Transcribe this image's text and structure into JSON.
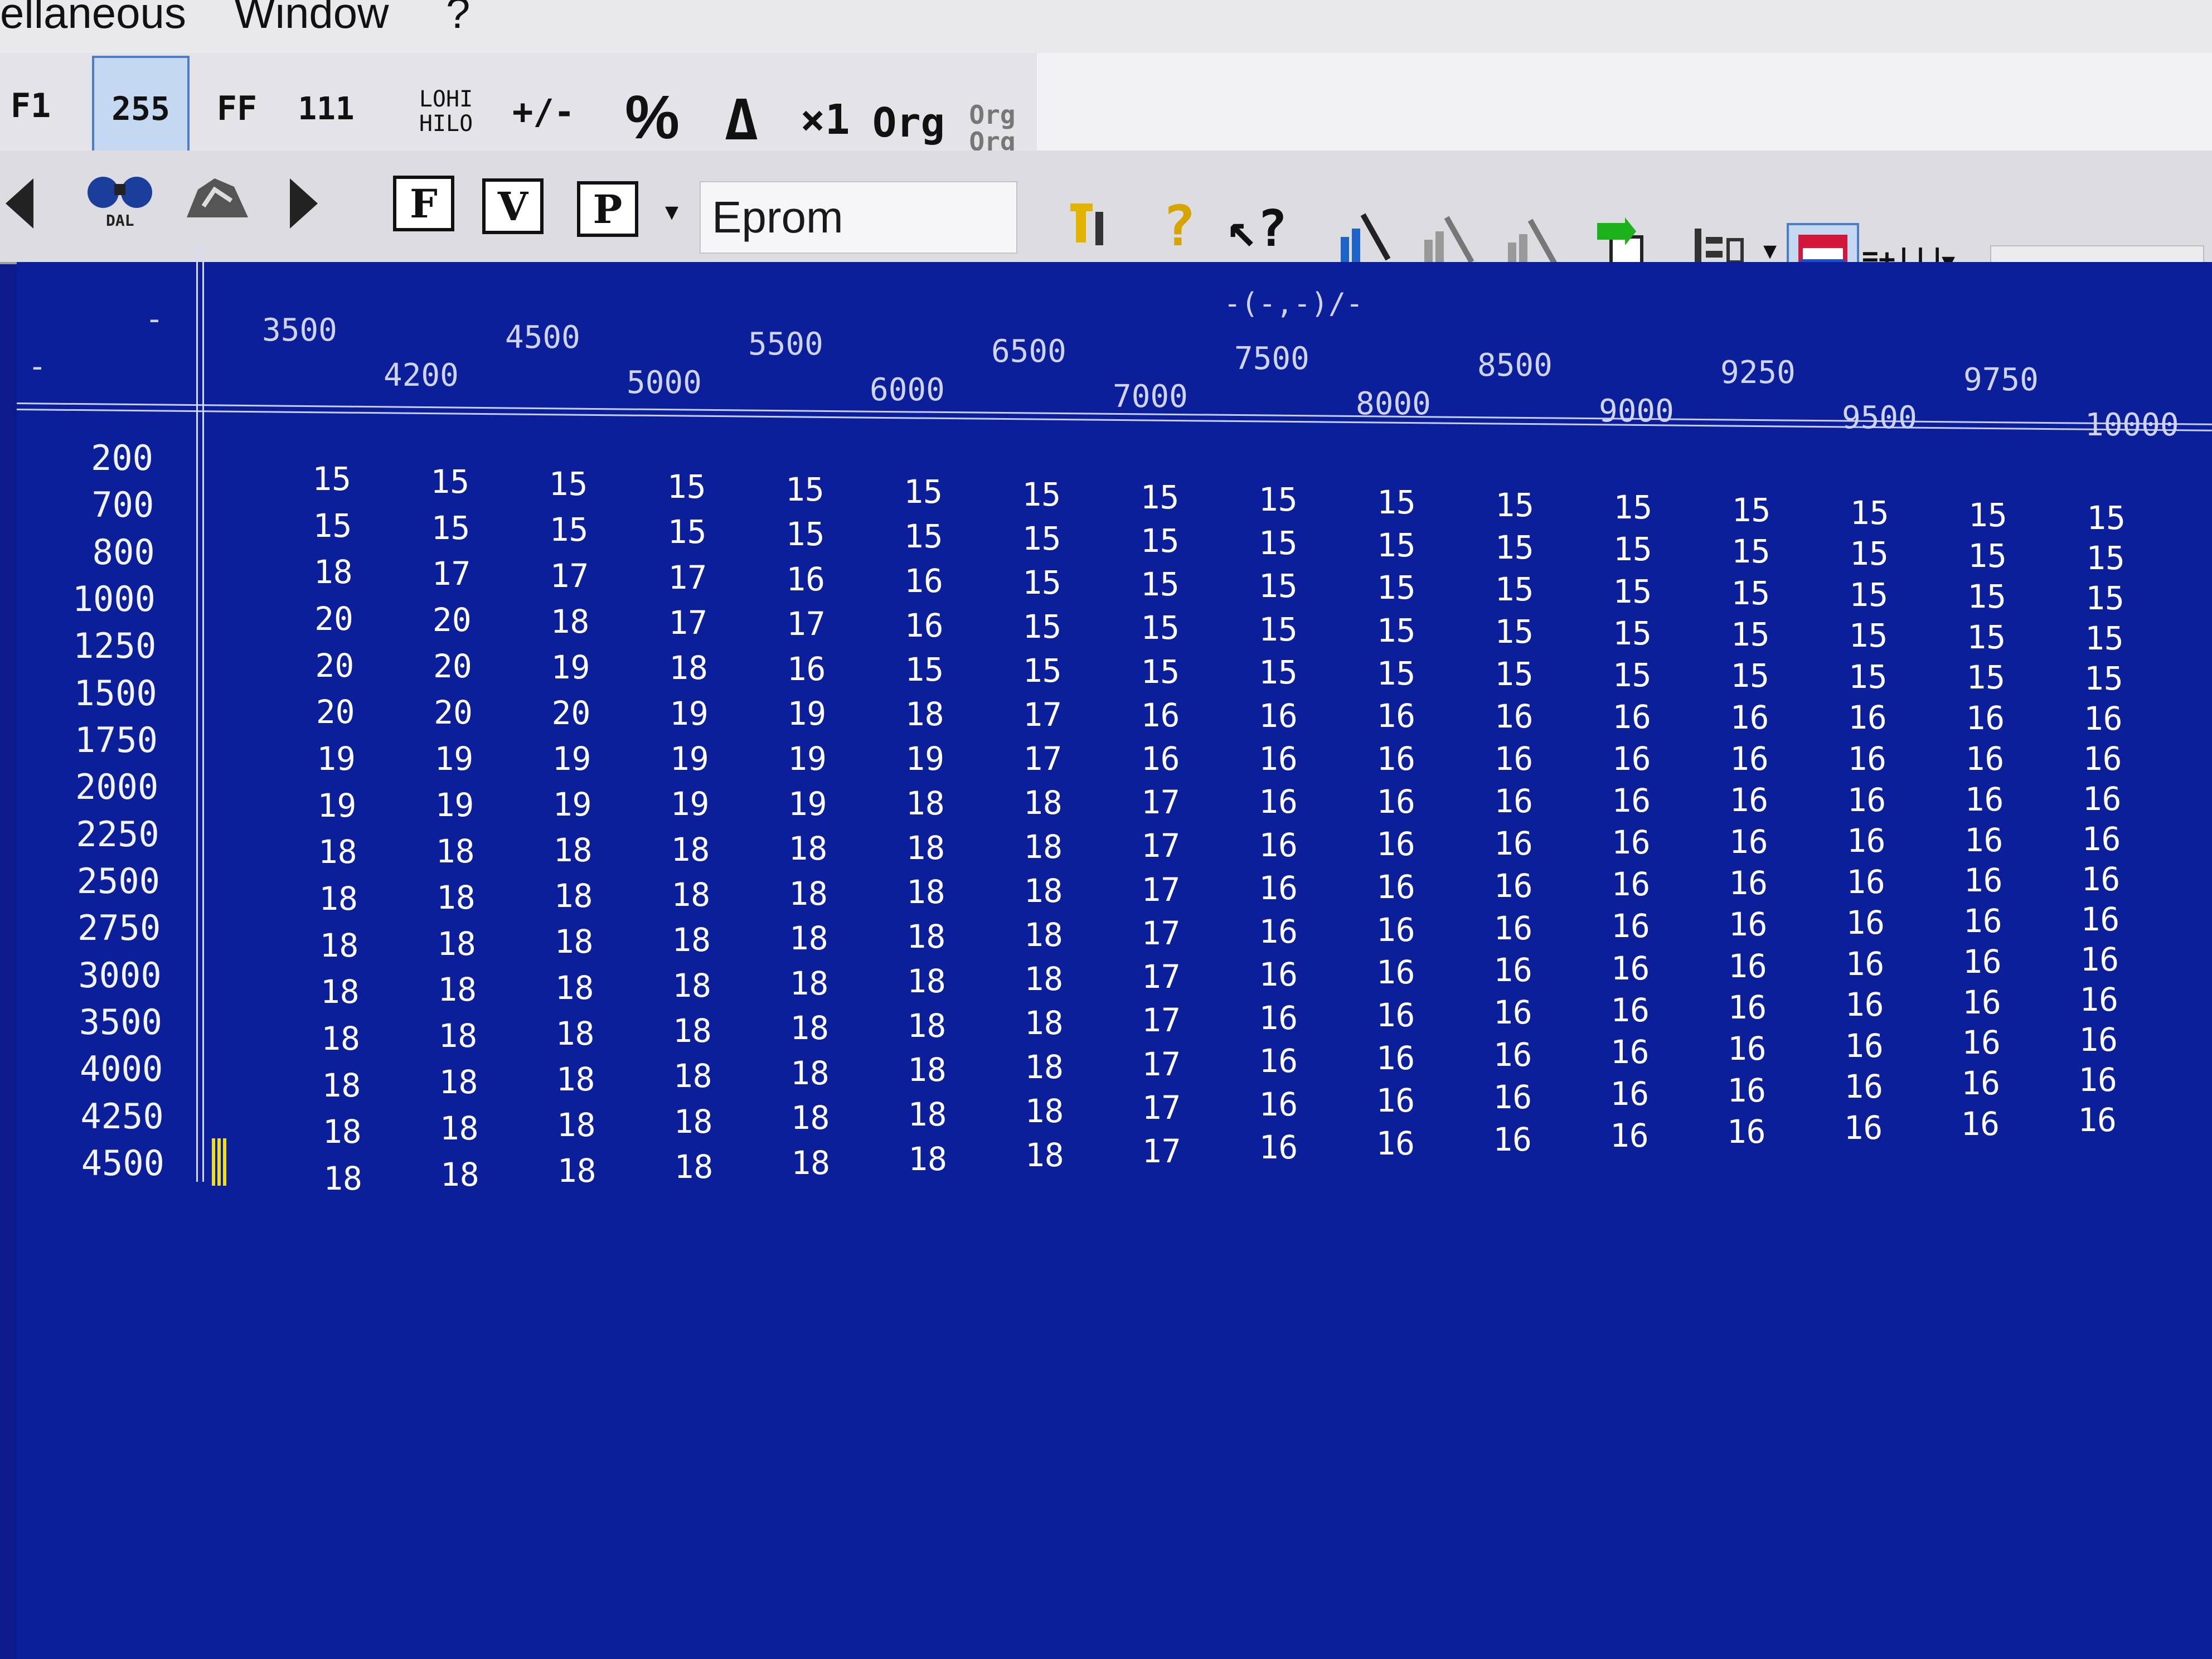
{
  "menu": {
    "miscellaneous": "ellaneous",
    "window": "Window",
    "help": "?"
  },
  "toolbar": {
    "buttons_row1": [
      {
        "icon": "decimal-view-icon",
        "label": "255"
      },
      {
        "icon": "hex-view-icon",
        "label": "FF"
      },
      {
        "icon": "binary-view-icon",
        "label": "111"
      },
      {
        "icon": "lohi-swap-icon",
        "label": "LOHI HILO"
      },
      {
        "icon": "sign-toggle-icon",
        "label": "+/-"
      },
      {
        "icon": "percent-icon",
        "label": "%"
      },
      {
        "icon": "delta-icon",
        "label": "Δ"
      },
      {
        "icon": "factor-icon",
        "label": "×1"
      },
      {
        "icon": "original-icon",
        "label": "Org"
      },
      {
        "icon": "original-compare-icon",
        "label": "Org Org"
      }
    ],
    "buttons_row2": [
      {
        "icon": "arrow-left-icon"
      },
      {
        "icon": "find-icon",
        "label": "DAL"
      },
      {
        "icon": "map-icon"
      },
      {
        "icon": "arrow-right-icon"
      },
      {
        "icon": "f-button-icon",
        "label": "F"
      },
      {
        "icon": "v-button-icon",
        "label": "V"
      },
      {
        "icon": "p-button-icon",
        "label": "P"
      }
    ],
    "mode_select": "Eprom",
    "right_icons": [
      "tools-icon",
      "help-icon",
      "context-help-icon",
      "chart-wand-icon",
      "chart-wand-2-icon",
      "chart-wand-3-icon",
      "import-icon",
      "layout-icon",
      "window-icon",
      "columns-icon"
    ]
  },
  "grid": {
    "axis_units": "-(-,-)/-",
    "row_axis_label": "-",
    "col_axis_label": "-",
    "columns": [
      "3500",
      "4200",
      "4500",
      "5000",
      "5500",
      "6000",
      "6500",
      "7000",
      "7500",
      "8000",
      "8500",
      "9000",
      "9250",
      "9500",
      "9750",
      "10000"
    ],
    "rows": [
      "200",
      "700",
      "800",
      "1000",
      "1250",
      "1500",
      "1750",
      "2000",
      "2250",
      "2500",
      "2750",
      "3000",
      "3500",
      "4000",
      "4250",
      "4500"
    ],
    "values": [
      [
        "15",
        "15",
        "15",
        "15",
        "15",
        "15",
        "15",
        "15",
        "15",
        "15",
        "15",
        "15",
        "15",
        "15",
        "15",
        "15"
      ],
      [
        "15",
        "15",
        "15",
        "15",
        "15",
        "15",
        "15",
        "15",
        "15",
        "15",
        "15",
        "15",
        "15",
        "15",
        "15",
        "15"
      ],
      [
        "18",
        "17",
        "17",
        "17",
        "16",
        "16",
        "15",
        "15",
        "15",
        "15",
        "15",
        "15",
        "15",
        "15",
        "15",
        "15"
      ],
      [
        "20",
        "20",
        "18",
        "17",
        "17",
        "16",
        "15",
        "15",
        "15",
        "15",
        "15",
        "15",
        "15",
        "15",
        "15",
        "15"
      ],
      [
        "20",
        "20",
        "19",
        "18",
        "16",
        "15",
        "15",
        "15",
        "15",
        "15",
        "15",
        "15",
        "15",
        "15",
        "15",
        "15"
      ],
      [
        "20",
        "20",
        "20",
        "19",
        "19",
        "18",
        "17",
        "16",
        "16",
        "16",
        "16",
        "16",
        "16",
        "16",
        "16",
        "16"
      ],
      [
        "19",
        "19",
        "19",
        "19",
        "19",
        "19",
        "17",
        "16",
        "16",
        "16",
        "16",
        "16",
        "16",
        "16",
        "16",
        "16"
      ],
      [
        "19",
        "19",
        "19",
        "19",
        "19",
        "18",
        "18",
        "17",
        "16",
        "16",
        "16",
        "16",
        "16",
        "16",
        "16",
        "16"
      ],
      [
        "18",
        "18",
        "18",
        "18",
        "18",
        "18",
        "18",
        "17",
        "16",
        "16",
        "16",
        "16",
        "16",
        "16",
        "16",
        "16"
      ],
      [
        "18",
        "18",
        "18",
        "18",
        "18",
        "18",
        "18",
        "17",
        "16",
        "16",
        "16",
        "16",
        "16",
        "16",
        "16",
        "16"
      ],
      [
        "18",
        "18",
        "18",
        "18",
        "18",
        "18",
        "18",
        "17",
        "16",
        "16",
        "16",
        "16",
        "16",
        "16",
        "16",
        "16"
      ],
      [
        "18",
        "18",
        "18",
        "18",
        "18",
        "18",
        "18",
        "17",
        "16",
        "16",
        "16",
        "16",
        "16",
        "16",
        "16",
        "16"
      ],
      [
        "18",
        "18",
        "18",
        "18",
        "18",
        "18",
        "18",
        "17",
        "16",
        "16",
        "16",
        "16",
        "16",
        "16",
        "16",
        "16"
      ],
      [
        "18",
        "18",
        "18",
        "18",
        "18",
        "18",
        "18",
        "17",
        "16",
        "16",
        "16",
        "16",
        "16",
        "16",
        "16",
        "16"
      ],
      [
        "18",
        "18",
        "18",
        "18",
        "18",
        "18",
        "18",
        "17",
        "16",
        "16",
        "16",
        "16",
        "16",
        "16",
        "16",
        "16"
      ],
      [
        "18",
        "18",
        "18",
        "18",
        "18",
        "18",
        "18",
        "17",
        "16",
        "16",
        "16",
        "16",
        "16",
        "16",
        "16",
        "16"
      ]
    ]
  }
}
